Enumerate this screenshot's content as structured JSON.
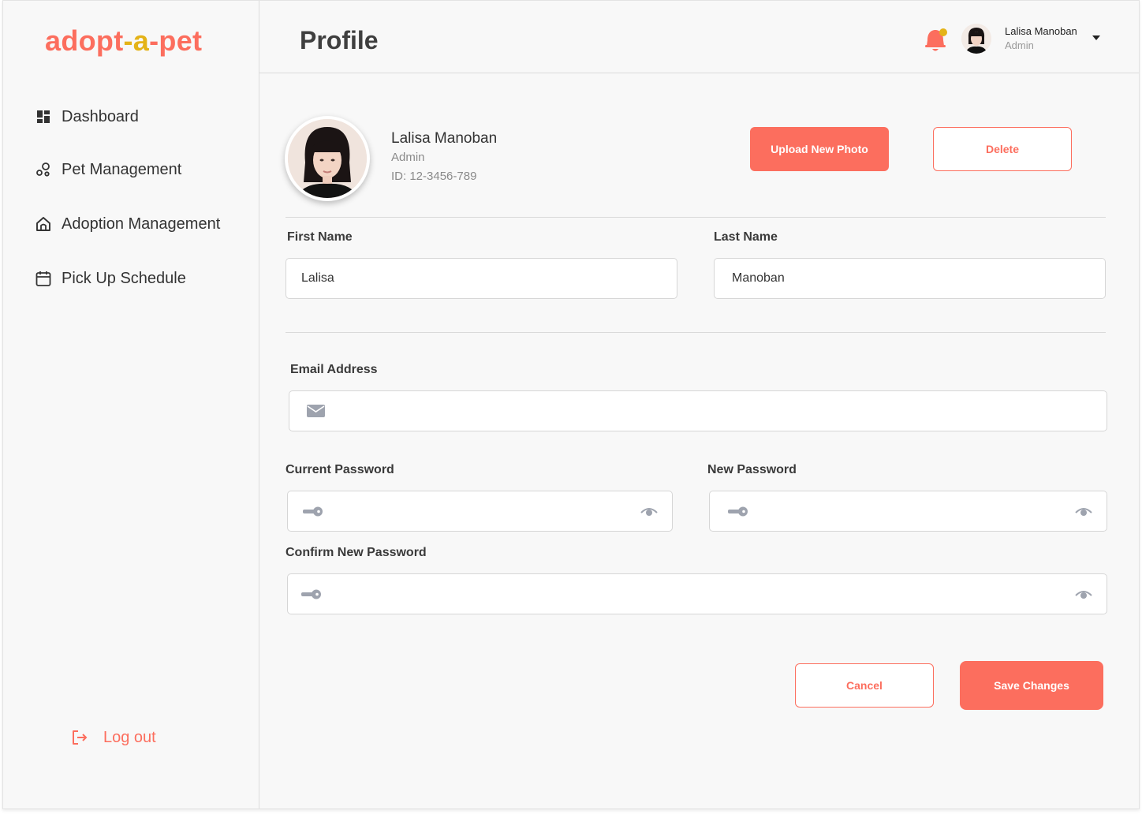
{
  "brand": {
    "logo_part1": "ado",
    "logo_part2": "pt",
    "logo_part3": "-",
    "logo_part4": "a",
    "logo_part5": "-pet",
    "primary": "#fc6e5e",
    "secondary": "#e4b318"
  },
  "sidebar": {
    "items": [
      {
        "label": "Dashboard",
        "icon": "dashboard-grid-icon"
      },
      {
        "label": "Pet Management",
        "icon": "pet-management-icon"
      },
      {
        "label": "Adoption Management",
        "icon": "home-icon"
      },
      {
        "label": "Pick Up Schedule",
        "icon": "calendar-icon"
      }
    ],
    "logout_label": "Log out"
  },
  "header": {
    "title": "Profile",
    "user_name": "Lalisa Manoban",
    "user_role": "Admin",
    "notification_dot_color": "#e4b318"
  },
  "profile": {
    "name": "Lalisa Manoban",
    "role": "Admin",
    "id_text": "ID: 12-3456-789",
    "upload_label": "Upload New Photo",
    "delete_label": "Delete"
  },
  "form": {
    "first_name_label": "First Name",
    "first_name_value": "Lalisa",
    "last_name_label": "Last Name",
    "last_name_value": "Manoban",
    "email_label": "Email Address",
    "email_value": "",
    "current_password_label": "Current Password",
    "new_password_label": "New Password",
    "confirm_password_label": "Confirm New Password",
    "cancel_label": "Cancel",
    "save_label": "Save Changes"
  }
}
